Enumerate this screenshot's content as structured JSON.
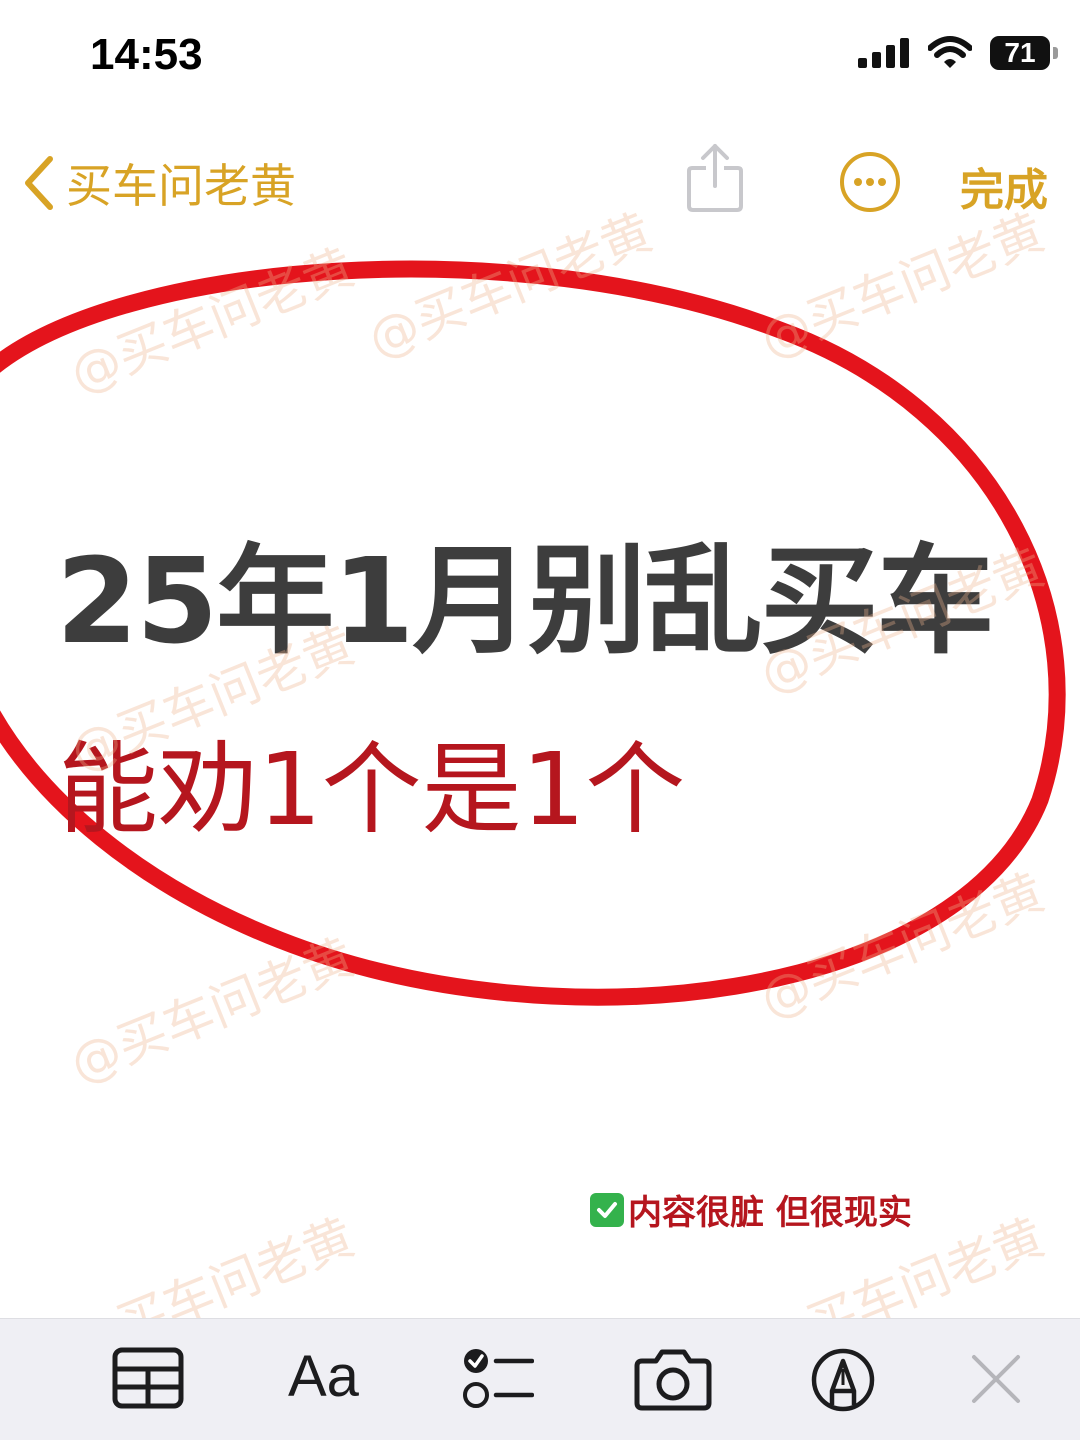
{
  "status_bar": {
    "time": "14:53",
    "battery": "71"
  },
  "nav": {
    "back_label": "买车问老黄",
    "done_label": "完成"
  },
  "watermark": {
    "text": "@买车问老黄"
  },
  "note": {
    "title": "25年1月别乱买车",
    "subtitle": "能劝1个是1个",
    "tag": "内容很脏 但很现实"
  },
  "toolbar": {
    "format_label": "Aa"
  },
  "colors": {
    "accent": "#d8a325",
    "annotation_red": "#e4141c",
    "subtitle_red": "#b5161e",
    "title_gray": "#3d3d3d",
    "check_green": "#34b24c",
    "toolbar_bg": "#efeff4"
  }
}
